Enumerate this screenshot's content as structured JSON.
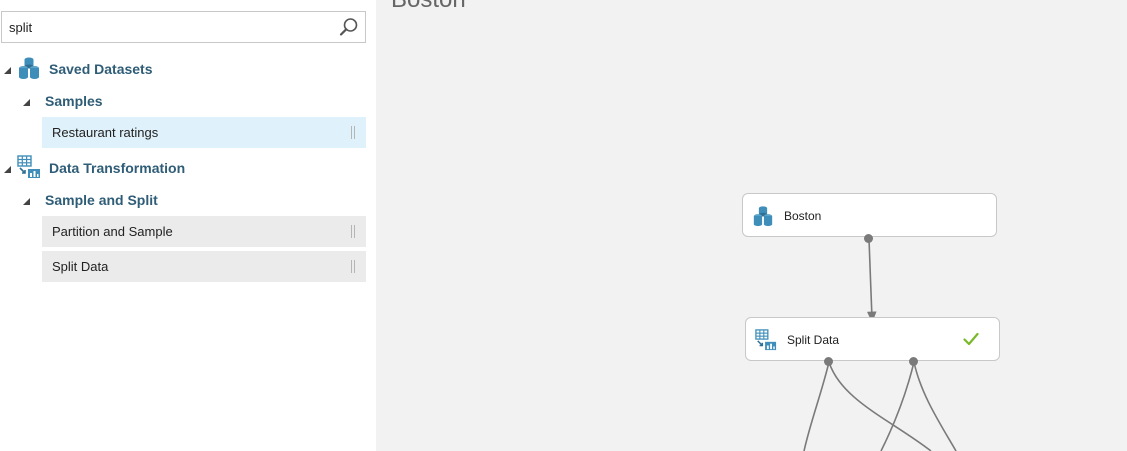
{
  "search": {
    "value": "split",
    "icon": "search-icon"
  },
  "palette": {
    "categories": [
      {
        "label": "Saved Datasets",
        "icon": "dataset-icon",
        "groups": [
          {
            "label": "Samples",
            "items": [
              {
                "label": "Restaurant ratings",
                "selected": true
              }
            ]
          }
        ]
      },
      {
        "label": "Data Transformation",
        "icon": "data-transformation-icon",
        "groups": [
          {
            "label": "Sample and Split",
            "items": [
              {
                "label": "Partition and Sample"
              },
              {
                "label": "Split Data"
              }
            ]
          }
        ]
      }
    ]
  },
  "canvas": {
    "title": "Boston",
    "nodes": [
      {
        "label": "Boston",
        "icon": "dataset-icon"
      },
      {
        "label": "Split Data",
        "icon": "data-transformation-icon",
        "status_icon": "checkmark-icon"
      }
    ]
  },
  "colors": {
    "category_text": "#2f5d77",
    "selected_item_bg": "#dff1fa",
    "item_bg": "#ebebeb",
    "canvas_bg": "#f2f2f2",
    "dataset_icon": "#3e8eb9",
    "success_check": "#7ab829"
  }
}
